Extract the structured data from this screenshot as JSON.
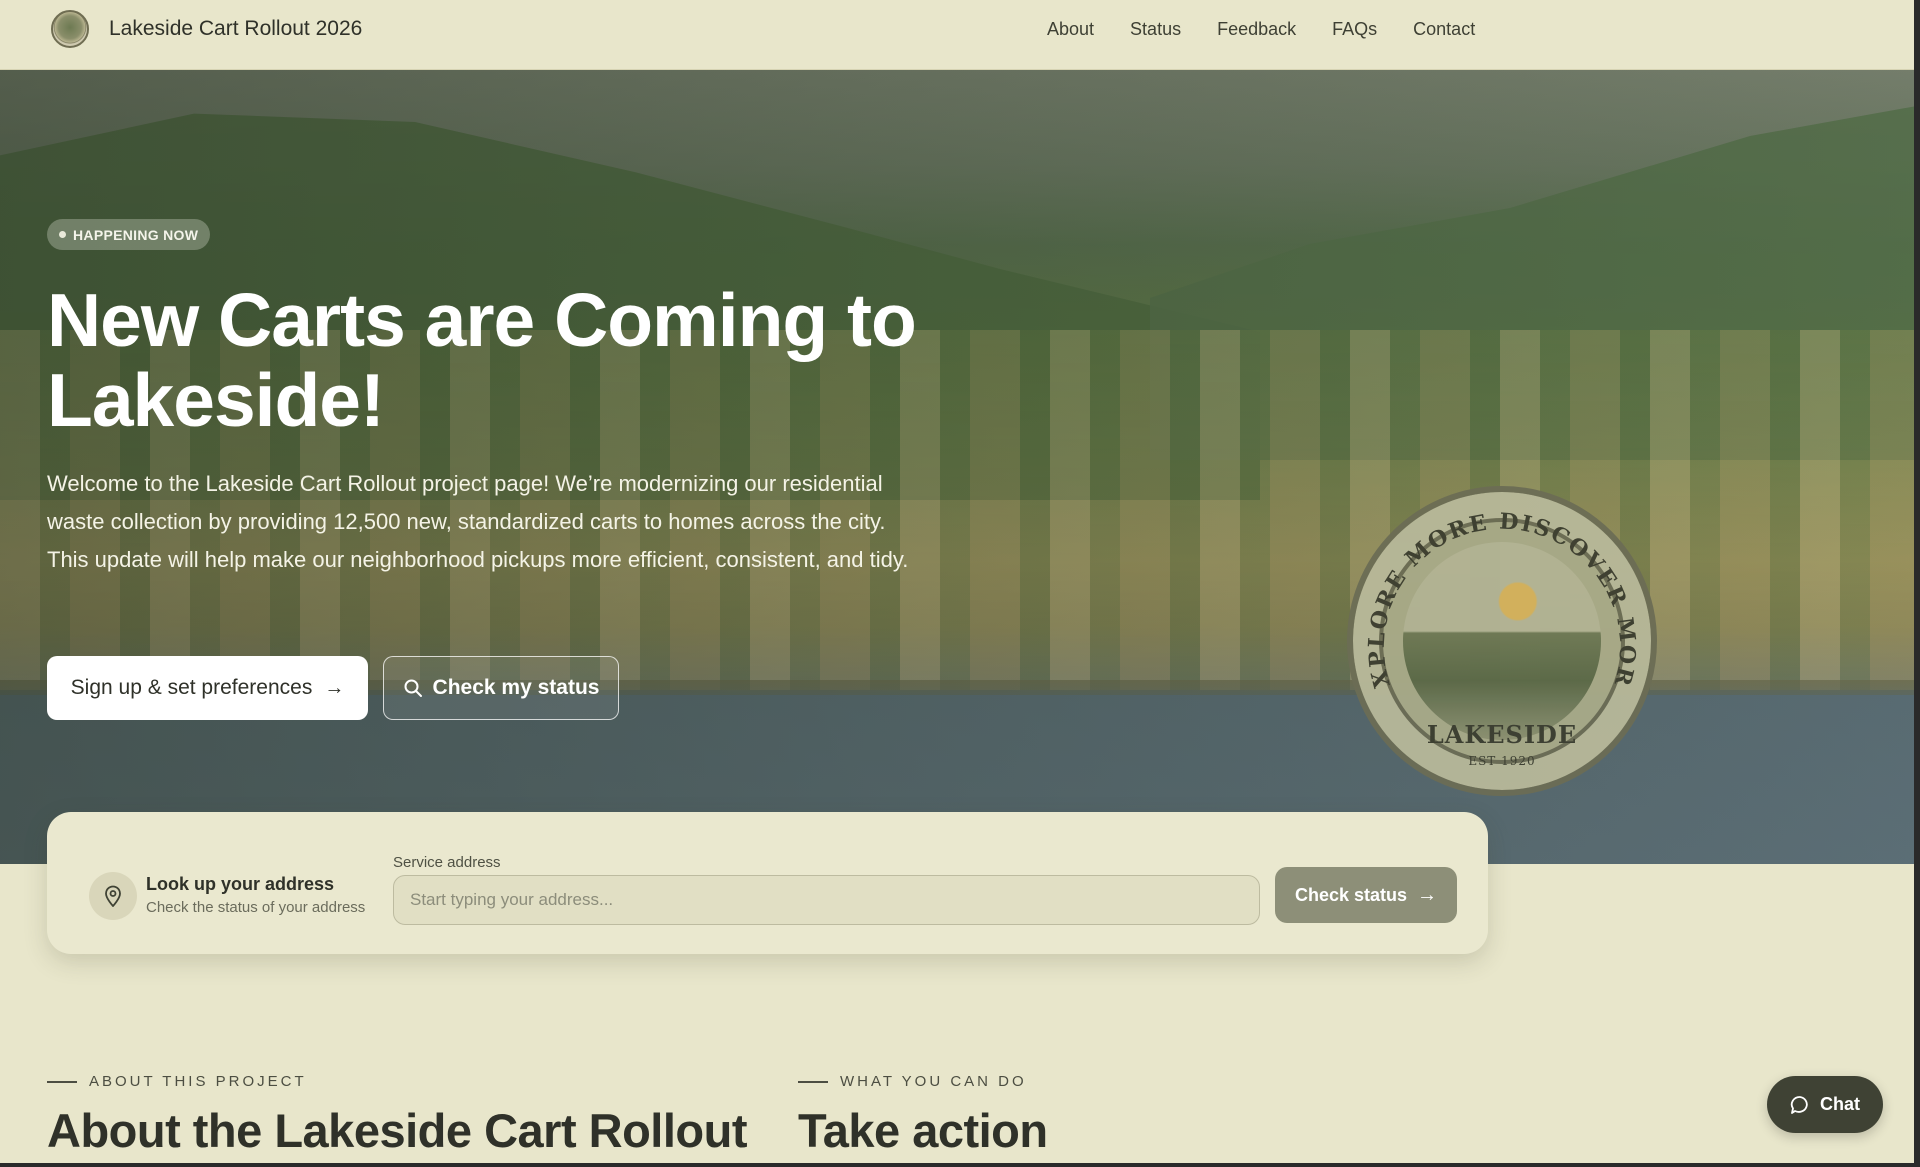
{
  "header": {
    "title": "Lakeside Cart Rollout 2026",
    "nav": [
      "About",
      "Status",
      "Feedback",
      "FAQs",
      "Contact"
    ]
  },
  "hero": {
    "badge": "HAPPENING NOW",
    "title": "New Carts are Coming to Lakeside!",
    "text": "Welcome to the Lakeside Cart Rollout project page! We’re modernizing our residential waste collection by providing 12,500 new, standardized carts to homes across the city. This update will help make our neighborhood pickups more efficient, consistent, and tidy.",
    "primary_button": "Sign up & set preferences",
    "secondary_button": "Check my status",
    "seal": {
      "name": "LAKESIDE",
      "est": "EST 1920",
      "motto": "EXPLORE MORE DISCOVER MORE"
    }
  },
  "lookup": {
    "title": "Look up your address",
    "subtitle": "Check the status of your address",
    "field_label": "Service address",
    "placeholder": "Start typing your address...",
    "button": "Check status"
  },
  "sections": {
    "about": {
      "eyebrow": "ABOUT THIS PROJECT",
      "title": "About the Lakeside Cart Rollout"
    },
    "action": {
      "eyebrow": "WHAT YOU CAN DO",
      "title": "Take action"
    }
  },
  "chat": {
    "label": "Chat"
  },
  "icons": {
    "arrow": "arrow-right-icon",
    "search": "search-icon",
    "pin": "map-pin-icon",
    "chat": "chat-bubble-icon"
  },
  "colors": {
    "background": "#e8e6cb",
    "button_dark": "#3f4234",
    "button_muted": "#8d8f78"
  }
}
